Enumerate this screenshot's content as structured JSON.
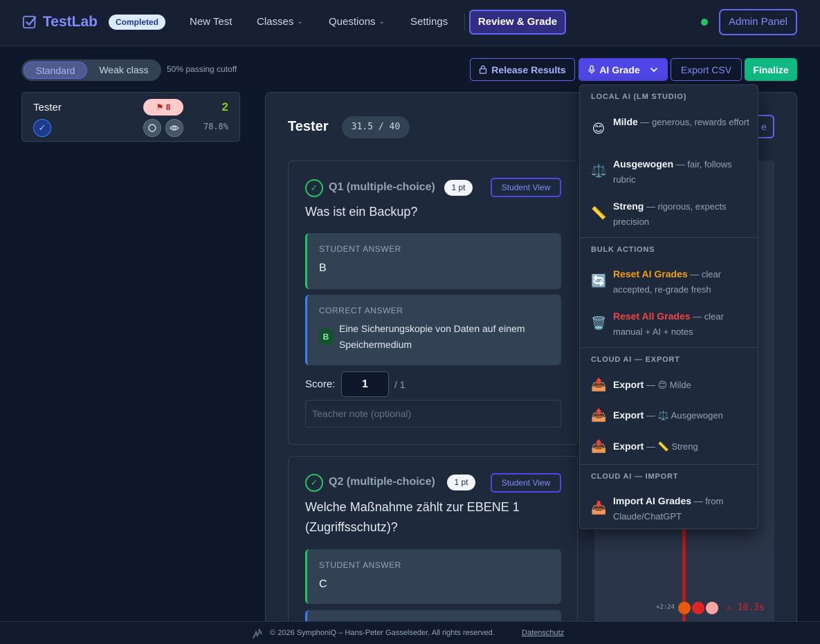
{
  "nav": {
    "brand": "TestLab",
    "status": "Completed",
    "links": [
      {
        "label": "New Test",
        "dropdown": false
      },
      {
        "label": "Classes",
        "dropdown": true
      },
      {
        "label": "Questions",
        "dropdown": true
      },
      {
        "label": "Settings",
        "dropdown": false
      }
    ],
    "active": "Review & Grade",
    "admin": "Admin Panel",
    "online_color": "#22c55e"
  },
  "toolbar": {
    "segment": {
      "standard": "Standard",
      "weak": "Weak class",
      "selected": "Standard"
    },
    "cutoff": "50% passing cutoff",
    "release": "Release Results",
    "ai_grade": "AI Grade",
    "export_csv": "Export CSV",
    "finalize": "Finalize"
  },
  "students": [
    {
      "name": "Tester",
      "flags": "8",
      "count": "2",
      "percent": "78.8%"
    }
  ],
  "review": {
    "student": "Tester",
    "score": "31.5 / 40",
    "timeline": {
      "offset": "+2:24",
      "warning": "⚠ 10.3s",
      "dot_colors": [
        "#ea580c",
        "#dc2626",
        "#fca5a5"
      ]
    }
  },
  "questions": [
    {
      "title": "Q1 (multiple-choice)",
      "points": "1 pt",
      "view_btn": "Student View",
      "text": "Was ist ein Backup?",
      "student_label": "STUDENT ANSWER",
      "student_answer": "B",
      "correct_label": "CORRECT ANSWER",
      "correct_letter": "B",
      "correct_text": "Eine Sicherungskopie von Daten auf einem Speichermedium",
      "score_label": "Score:",
      "score_value": "1",
      "score_max": "/ 1",
      "note_placeholder": "Teacher note (optional)"
    },
    {
      "title": "Q2 (multiple-choice)",
      "points": "1 pt",
      "view_btn": "Student View",
      "text": "Welche Maßnahme zählt zur EBENE 1 (Zugriffsschutz)?",
      "student_label": "STUDENT ANSWER",
      "student_answer": "C"
    }
  ],
  "ai_menu": {
    "local_head": "LOCAL AI (LM STUDIO)",
    "local": [
      {
        "icon": "😊",
        "name": "Milde",
        "desc": "— generous, rewards effort"
      },
      {
        "icon": "⚖️",
        "name": "Ausgewogen",
        "desc": "— fair, follows rubric"
      },
      {
        "icon": "📏",
        "name": "Streng",
        "desc": "— rigorous, expects precision"
      }
    ],
    "bulk_head": "BULK ACTIONS",
    "bulk": [
      {
        "icon": "🔄",
        "name": "Reset AI Grades",
        "desc": "— clear accepted, re-grade fresh"
      },
      {
        "icon": "🗑️",
        "name": "Reset All Grades",
        "desc": "— clear manual + AI + notes"
      }
    ],
    "export_head": "CLOUD AI — EXPORT",
    "export": [
      {
        "icon": "📤",
        "name": "Export",
        "desc": "— 😊 Milde"
      },
      {
        "icon": "📤",
        "name": "Export",
        "desc": "— ⚖️ Ausgewogen"
      },
      {
        "icon": "📤",
        "name": "Export",
        "desc": "— 📏 Streng"
      }
    ],
    "import_head": "CLOUD AI — IMPORT",
    "import": [
      {
        "icon": "📥",
        "name": "Import AI Grades",
        "desc": "— from Claude/ChatGPT"
      }
    ]
  },
  "footer": {
    "copyright": "© 2026 SymphoniQ – Hans-Peter Gasselseder. All rights reserved.",
    "privacy": "Datenschutz"
  }
}
